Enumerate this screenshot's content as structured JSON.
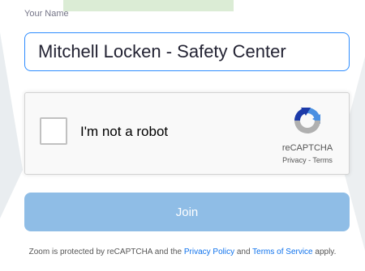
{
  "form": {
    "name_label": "Your Name",
    "name_value": "Mitchell Locken - Safety Center"
  },
  "recaptcha": {
    "checkbox_label": "I'm not a robot",
    "brand": "reCAPTCHA",
    "privacy_link": "Privacy",
    "separator": " - ",
    "terms_link": "Terms",
    "checked": false,
    "logo_icon": "recaptcha-logo-icon",
    "colors": {
      "blue": "#4a90e2",
      "dark_blue": "#1c3aa9",
      "grey": "#b0b0b0"
    }
  },
  "join_button": {
    "label": "Join",
    "color": "#8fbde6"
  },
  "footer": {
    "prefix": "Zoom is protected by reCAPTCHA and the ",
    "privacy_policy": "Privacy Policy",
    "and": " and ",
    "terms_of_service": "Terms of Service",
    "suffix": " apply.",
    "link_color": "#0e72ed"
  }
}
